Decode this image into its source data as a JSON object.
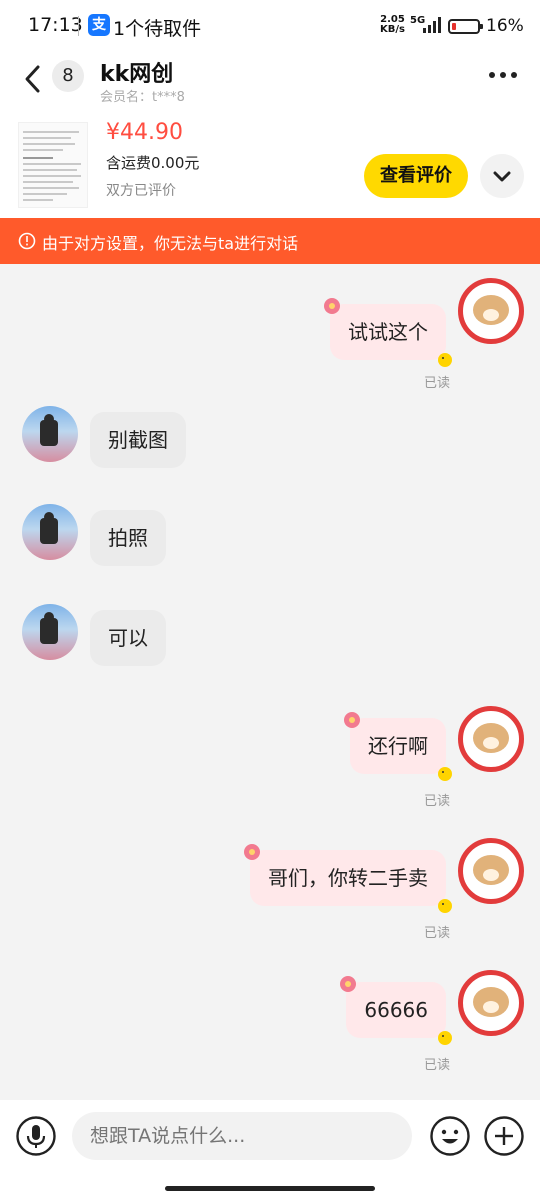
{
  "status_bar": {
    "time": "17:13",
    "app_icon_glyph": "支",
    "notification": "1个待取件",
    "net_speed": "2.05",
    "net_speed_unit": "KB/s",
    "network": "5G",
    "battery_percent": "16%",
    "battery_level": 0.16
  },
  "header": {
    "unread_count": "8",
    "title": "kk网创",
    "member_name": "会员名：t***8"
  },
  "product": {
    "price": "¥44.90",
    "shipping": "含运费0.00元",
    "review_status": "双方已评价",
    "review_button": "查看评价"
  },
  "notice": {
    "text": "由于对方设置，你无法与ta进行对话"
  },
  "messages": [
    {
      "side": "out",
      "text": "试试这个",
      "read": "已读"
    },
    {
      "side": "in",
      "text": "别截图"
    },
    {
      "side": "in",
      "text": "拍照"
    },
    {
      "side": "in",
      "text": "可以"
    },
    {
      "side": "out",
      "text": "还行啊",
      "read": "已读"
    },
    {
      "side": "out",
      "text": "哥们，你转二手卖",
      "read": "已读"
    },
    {
      "side": "out",
      "text": "66666",
      "read": "已读"
    }
  ],
  "input": {
    "placeholder": "想跟TA说点什么..."
  },
  "colors": {
    "accent_yellow": "#ffd900",
    "notice_orange": "#ff5a2b",
    "price_red": "#ff4d40",
    "out_bubble": "#ffe8ea",
    "in_bubble": "#ebebeb"
  }
}
